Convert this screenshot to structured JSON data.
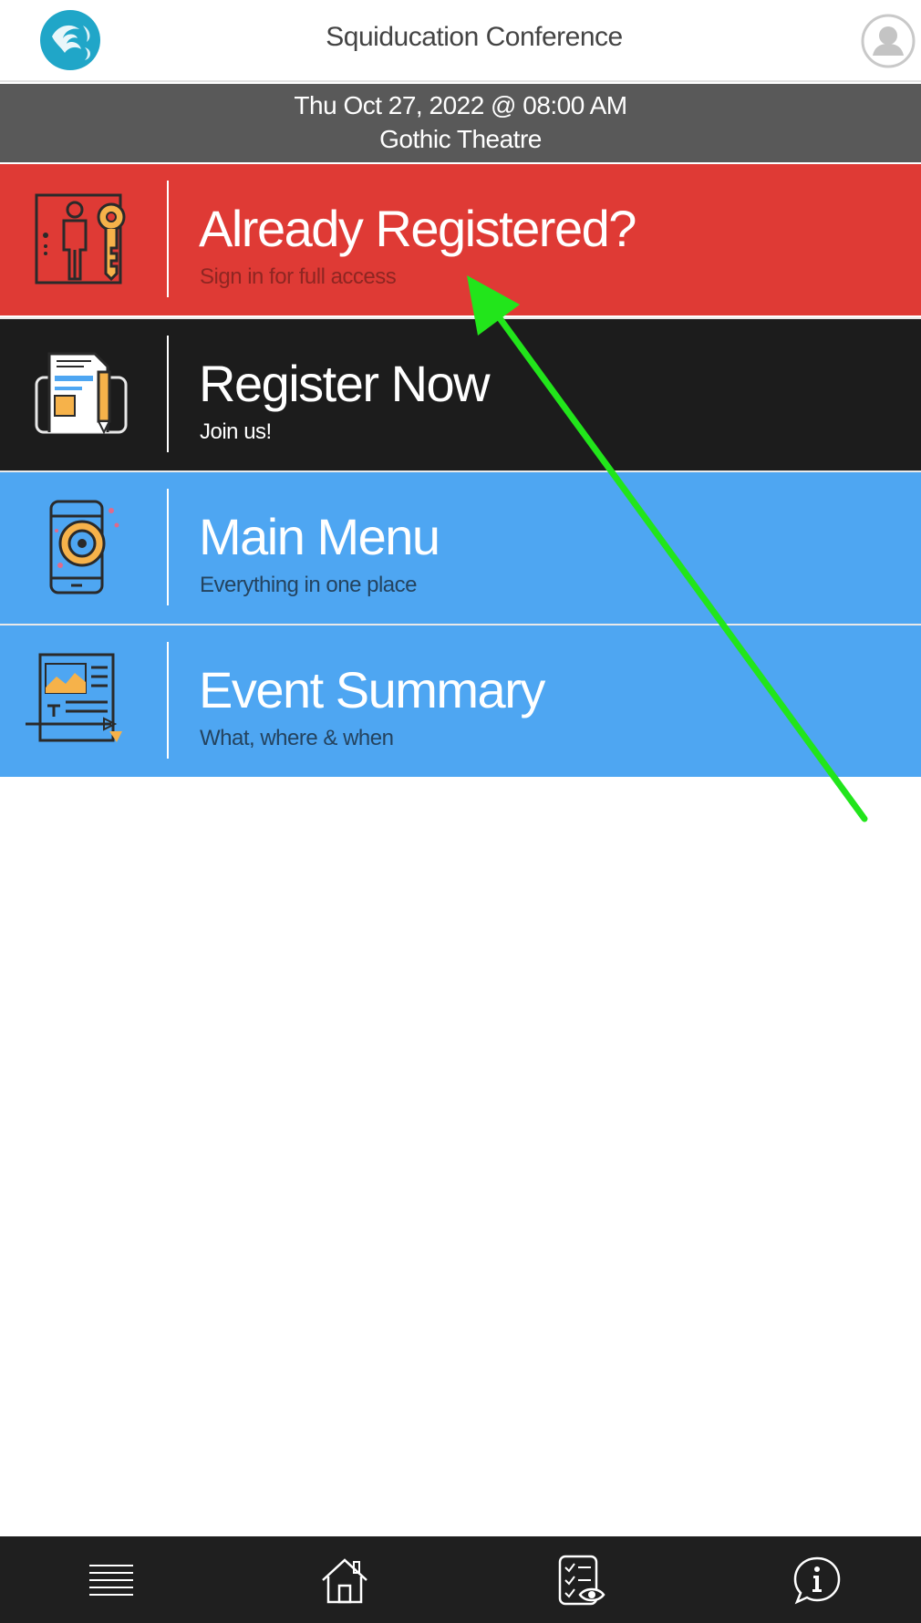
{
  "header": {
    "title": "Squiducation Conference",
    "logo_icon": "squid-logo-icon",
    "avatar_icon": "user-avatar-icon"
  },
  "event": {
    "date": "Thu Oct 27, 2022 @ 08:00 AM",
    "venue": "Gothic Theatre"
  },
  "tiles": [
    {
      "title": "Already Registered?",
      "subtitle": "Sign in for full access",
      "icon": "elevator-key-icon",
      "color": "#df3a35"
    },
    {
      "title": "Register Now",
      "subtitle": "Join us!",
      "icon": "document-pen-icon",
      "color": "#1c1c1c"
    },
    {
      "title": "Main Menu",
      "subtitle": "Everything in one place",
      "icon": "phone-camera-icon",
      "color": "#4ea6f2"
    },
    {
      "title": "Event Summary",
      "subtitle": "What, where & when",
      "icon": "scroll-summary-icon",
      "color": "#4ea6f2"
    }
  ],
  "bottom_nav": [
    {
      "icon": "hamburger-menu-icon"
    },
    {
      "icon": "home-icon"
    },
    {
      "icon": "checklist-eye-icon"
    },
    {
      "icon": "info-bubble-icon"
    }
  ],
  "colors": {
    "accent_red": "#df3a35",
    "accent_blue": "#4ea6f2",
    "dark": "#1c1c1c",
    "event_bar": "#595959",
    "annotation_arrow": "#22e51b"
  }
}
